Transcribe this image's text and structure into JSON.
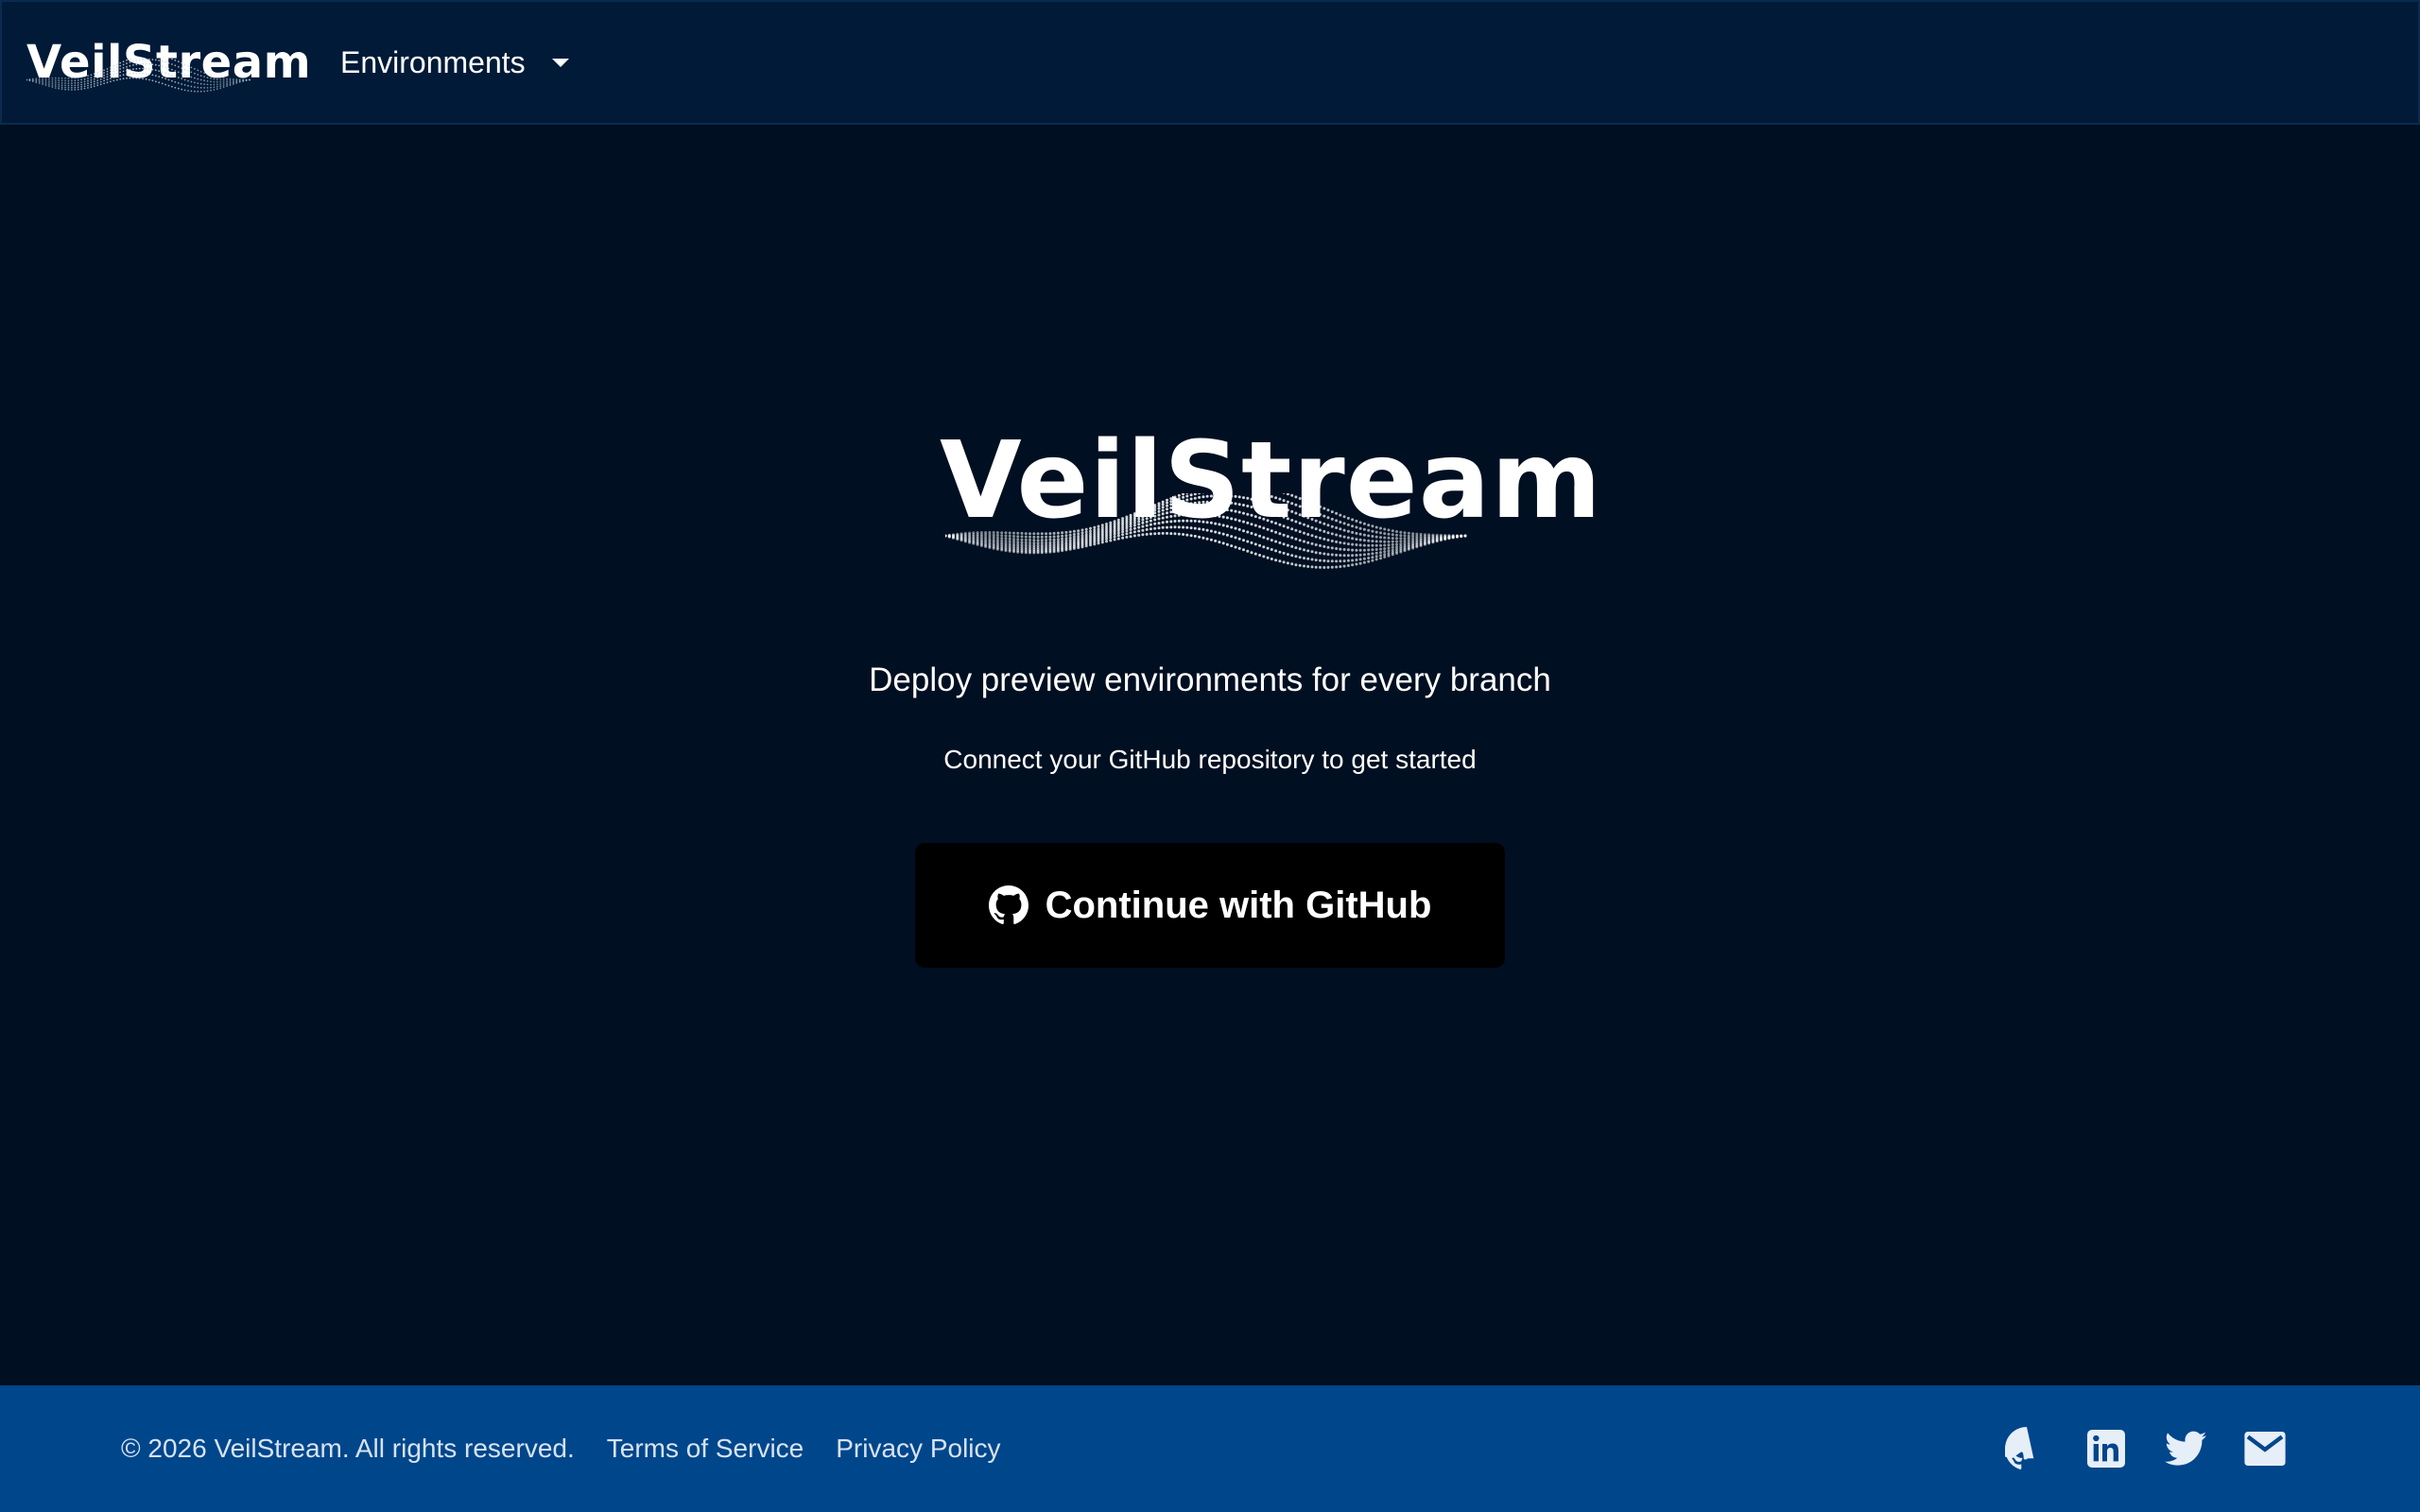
{
  "header": {
    "brand": "VeilStream",
    "nav_environments": "Environments"
  },
  "hero": {
    "brand": "VeilStream",
    "tagline": "Deploy preview environments for every branch",
    "subtagline": "Connect your GitHub repository to get started",
    "cta_label": "Continue with GitHub"
  },
  "footer": {
    "copyright": "© 2026 VeilStream. All rights reserved.",
    "terms": "Terms of Service",
    "privacy": "Privacy Policy",
    "social_icons": [
      "github-icon",
      "linkedin-icon",
      "twitter-icon",
      "mail-icon"
    ]
  },
  "colors": {
    "page_background": "#000f21",
    "header_background": "#001a37",
    "footer_background": "#00468b",
    "button_background": "#000000",
    "text": "#ffffff",
    "footer_text": "#d7e3f2"
  }
}
